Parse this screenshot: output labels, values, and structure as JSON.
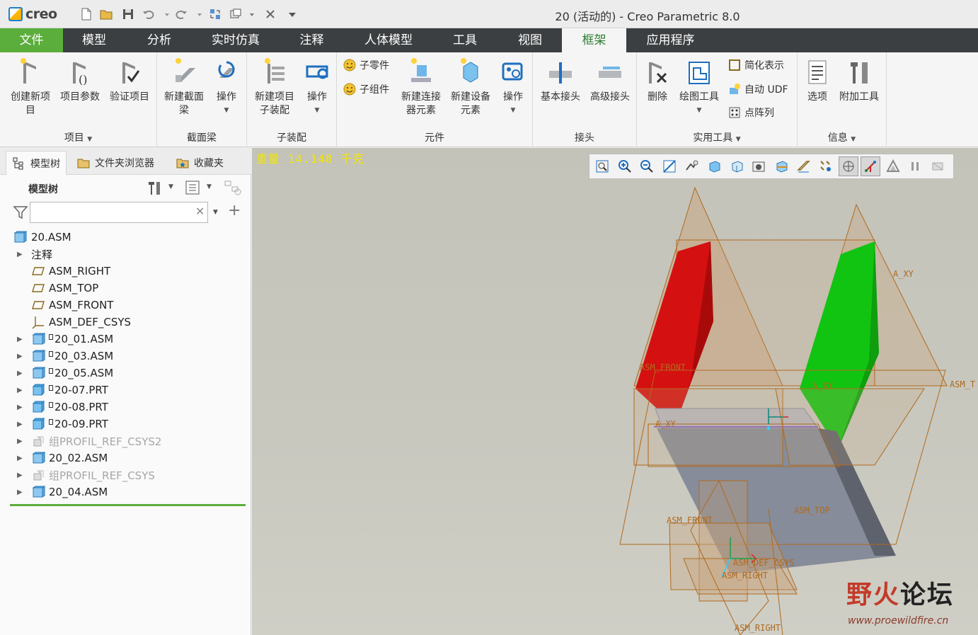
{
  "app": {
    "logo_text": "creo",
    "window_title": "20 (活动的) - Creo Parametric 8.0"
  },
  "tabs": [
    "文件",
    "模型",
    "分析",
    "实时仿真",
    "注释",
    "人体模型",
    "工具",
    "视图",
    "框架",
    "应用程序"
  ],
  "active_tab": "框架",
  "ribbon": {
    "groups": {
      "project": "项目",
      "section_beam": "截面梁",
      "subassembly": "子装配",
      "component": "元件",
      "joint": "接头",
      "utility": "实用工具",
      "info": "信息"
    },
    "buttons": {
      "create_project_1": "创建新项",
      "create_project_2": "目",
      "project_params": "项目参数",
      "verify_project": "验证项目",
      "new_section_beam_1": "新建截面",
      "new_section_beam_2": "梁",
      "operations_1": "操作",
      "new_project_sub_1": "新建项目",
      "new_project_sub_2": "子装配",
      "operations_2": "操作",
      "sub_part": "子零件",
      "sub_component": "子组件",
      "new_connector_1": "新建连接",
      "new_connector_2": "器元素",
      "new_equipment_1": "新建设备",
      "new_equipment_2": "元素",
      "operations_3": "操作",
      "basic_joint": "基本接头",
      "advanced_joint": "高级接头",
      "delete": "删除",
      "drawing_tools": "绘图工具",
      "simplified_rep": "简化表示",
      "auto_udf": "自动 UDF",
      "point_array": "点阵列",
      "options": "选项",
      "extra_tools": "附加工具"
    }
  },
  "left_panel": {
    "tabs": [
      "模型树",
      "文件夹浏览器",
      "收藏夹"
    ],
    "tree_title": "模型树",
    "search_value": "",
    "items": [
      {
        "label": "20.ASM",
        "icon": "assembly-icon",
        "expand": "",
        "dim": false,
        "indent": 0
      },
      {
        "label": "注释",
        "icon": "",
        "expand": "▶",
        "dim": false,
        "indent": 1
      },
      {
        "label": "ASM_RIGHT",
        "icon": "datum-plane-icon",
        "expand": "",
        "dim": false,
        "indent": 2
      },
      {
        "label": "ASM_TOP",
        "icon": "datum-plane-icon",
        "expand": "",
        "dim": false,
        "indent": 2
      },
      {
        "label": "ASM_FRONT",
        "icon": "datum-plane-icon",
        "expand": "",
        "dim": false,
        "indent": 2
      },
      {
        "label": "ASM_DEF_CSYS",
        "icon": "csys-icon",
        "expand": "",
        "dim": false,
        "indent": 2
      },
      {
        "label": "20_01.ASM",
        "icon": "assembly-icon",
        "expand": "▶",
        "dim": false,
        "indent": 2,
        "flag": true
      },
      {
        "label": "20_03.ASM",
        "icon": "assembly-icon",
        "expand": "▶",
        "dim": false,
        "indent": 2,
        "flag": true
      },
      {
        "label": "20_05.ASM",
        "icon": "assembly-icon",
        "expand": "▶",
        "dim": false,
        "indent": 2,
        "flag": true
      },
      {
        "label": "20-07.PRT",
        "icon": "part-icon",
        "expand": "▶",
        "dim": false,
        "indent": 2,
        "flag": true
      },
      {
        "label": "20-08.PRT",
        "icon": "part-icon",
        "expand": "▶",
        "dim": false,
        "indent": 2,
        "flag": true
      },
      {
        "label": "20-09.PRT",
        "icon": "part-icon",
        "expand": "▶",
        "dim": false,
        "indent": 2,
        "flag": true
      },
      {
        "label": "组PROFIL_REF_CSYS2",
        "icon": "group-icon",
        "expand": "▶",
        "dim": true,
        "indent": 2
      },
      {
        "label": "20_02.ASM",
        "icon": "assembly-icon",
        "expand": "▶",
        "dim": false,
        "indent": 2
      },
      {
        "label": "组PROFIL_REF_CSYS",
        "icon": "group-icon",
        "expand": "▶",
        "dim": true,
        "indent": 2
      },
      {
        "label": "20_04.ASM",
        "icon": "assembly-icon",
        "expand": "▶",
        "dim": false,
        "indent": 2
      }
    ]
  },
  "viewport": {
    "mass_text": "重量 14.148 千克",
    "labels": {
      "a_xy": "A_XY",
      "asm_front_top": "ASM_FRONT",
      "asm_t": "ASM_T",
      "a_xy_mid": "A_XY",
      "a_xy_left": "A_XY",
      "asm_front_low": "ASM_FRONT",
      "asm_top_low": "ASM_TOP",
      "asm_def_csys": "ASM_DEF_CSYS",
      "asm_right_low": "ASM_RIGHT",
      "asm_right_bottom": "ASM_RIGHT"
    },
    "toolbar_icons": [
      "refit-icon",
      "zoom-in-icon",
      "zoom-out-icon",
      "repaint-icon",
      "saved-orientations-icon",
      "display-style-icon",
      "view-manager-icon",
      "perspective-icon",
      "section-icon",
      "datum-display-icon",
      "annotation-display-icon",
      "spin-center-icon",
      "csys-display-icon",
      "model-display-icon",
      "pause-icon",
      "hide-icon"
    ],
    "colors": {
      "red_panel": "#d41010",
      "green_panel": "#11c411",
      "datum_plane": "#b06a1f"
    }
  },
  "watermark": {
    "title_a": "野火",
    "title_b": "论坛",
    "url": "www.proewildfire.cn"
  }
}
